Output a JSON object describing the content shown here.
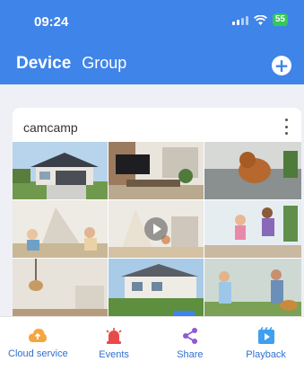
{
  "status_bar": {
    "time": "09:24",
    "battery": "55",
    "icons": [
      "signal-icon",
      "wifi-icon",
      "battery-icon"
    ]
  },
  "header": {
    "tabs": [
      "Device",
      "Group"
    ],
    "active_tab": "Device",
    "add_icon": "plus-circle-icon",
    "background_color": "#3f84e8"
  },
  "device_card": {
    "name": "camcamp",
    "more_icon": "vertical-dots-icon",
    "thumbnails": [
      "house-garage",
      "living-room-tv",
      "dog-on-sofa",
      "kids-play-tent",
      "kids-room-play",
      "kids-jumping",
      "room-lamp",
      "house-exterior",
      "woman-man-dog-yard"
    ]
  },
  "bottom_nav": {
    "items": [
      {
        "label": "Cloud service",
        "icon": "cloud-upload-icon",
        "color": "#f4a640"
      },
      {
        "label": "Events",
        "icon": "alarm-siren-icon",
        "color": "#e84a4a"
      },
      {
        "label": "Share",
        "icon": "share-icon",
        "color": "#8e5ad6"
      },
      {
        "label": "Playback",
        "icon": "playback-icon",
        "color": "#3f9ff0"
      }
    ]
  }
}
